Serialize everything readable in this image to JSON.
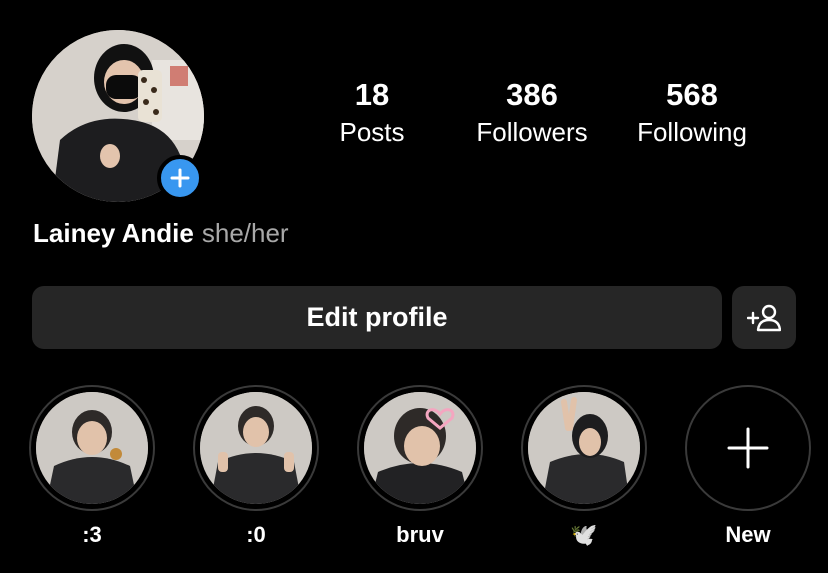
{
  "profile": {
    "name": "Lainey Andie",
    "pronouns": "she/her"
  },
  "stats": [
    {
      "value": "18",
      "label": "Posts"
    },
    {
      "value": "386",
      "label": "Followers"
    },
    {
      "value": "568",
      "label": "Following"
    }
  ],
  "actions": {
    "edit_profile_label": "Edit profile"
  },
  "highlights": [
    {
      "label": ":3"
    },
    {
      "label": ":0"
    },
    {
      "label": "bruv"
    },
    {
      "label": "🕊️"
    },
    {
      "label": "New"
    }
  ],
  "colors": {
    "background": "#000000",
    "button_bg": "#262626",
    "accent_blue": "#3897f0",
    "secondary_text": "#a8a8a8"
  }
}
